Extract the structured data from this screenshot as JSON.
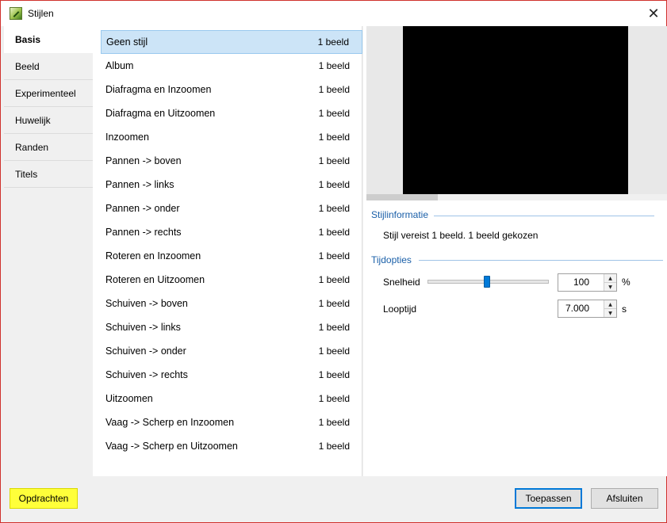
{
  "window": {
    "title": "Stijlen",
    "close_glyph": "✕"
  },
  "tabs": [
    {
      "label": "Basis",
      "active": true
    },
    {
      "label": "Beeld",
      "active": false
    },
    {
      "label": "Experimenteel",
      "active": false
    },
    {
      "label": "Huwelijk",
      "active": false
    },
    {
      "label": "Randen",
      "active": false
    },
    {
      "label": "Titels",
      "active": false
    }
  ],
  "styles": [
    {
      "name": "Geen stijl",
      "count": "1 beeld",
      "selected": true
    },
    {
      "name": "Album",
      "count": "1 beeld"
    },
    {
      "name": "Diafragma en Inzoomen",
      "count": "1 beeld"
    },
    {
      "name": "Diafragma en Uitzoomen",
      "count": "1 beeld"
    },
    {
      "name": "Inzoomen",
      "count": "1 beeld"
    },
    {
      "name": "Pannen -> boven",
      "count": "1 beeld"
    },
    {
      "name": "Pannen -> links",
      "count": "1 beeld"
    },
    {
      "name": "Pannen -> onder",
      "count": "1 beeld"
    },
    {
      "name": "Pannen -> rechts",
      "count": "1 beeld"
    },
    {
      "name": "Roteren en Inzoomen",
      "count": "1 beeld"
    },
    {
      "name": "Roteren en Uitzoomen",
      "count": "1 beeld"
    },
    {
      "name": "Schuiven -> boven",
      "count": "1 beeld"
    },
    {
      "name": "Schuiven -> links",
      "count": "1 beeld"
    },
    {
      "name": "Schuiven -> onder",
      "count": "1 beeld"
    },
    {
      "name": "Schuiven -> rechts",
      "count": "1 beeld"
    },
    {
      "name": "Uitzoomen",
      "count": "1 beeld"
    },
    {
      "name": "Vaag -> Scherp en Inzoomen",
      "count": "1 beeld"
    },
    {
      "name": "Vaag -> Scherp en Uitzoomen",
      "count": "1 beeld"
    }
  ],
  "info": {
    "group_title": "Stijlinformatie",
    "text": "Stijl vereist 1 beeld. 1 beeld gekozen"
  },
  "timing": {
    "group_title": "Tijdopties",
    "speed_label": "Snelheid",
    "speed_value": "100",
    "speed_unit": "%",
    "speed_slider_fraction": 0.5,
    "duration_label": "Looptijd",
    "duration_value": "7.000",
    "duration_unit": "s"
  },
  "footer": {
    "commands_label": "Opdrachten",
    "apply_label": "Toepassen",
    "close_label": "Afsluiten"
  },
  "colors": {
    "selection_bg": "#cce4f7",
    "accent": "#0078d7",
    "highlight": "#ffff3a",
    "group_title": "#1a5fa8"
  }
}
